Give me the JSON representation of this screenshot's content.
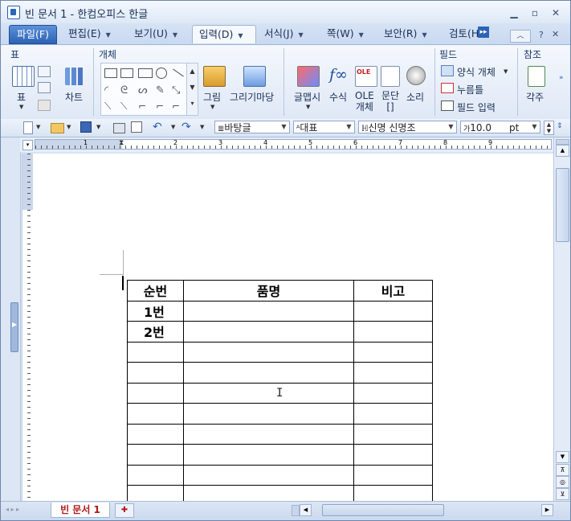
{
  "window": {
    "title": "빈 문서 1 - 한컴오피스 한글"
  },
  "menu_tabs": [
    {
      "label": "파일(F)"
    },
    {
      "label": "편집(E)"
    },
    {
      "label": "보기(U)"
    },
    {
      "label": "입력(D)"
    },
    {
      "label": "서식(J)"
    },
    {
      "label": "쪽(W)"
    },
    {
      "label": "보안(R)"
    },
    {
      "label": "검토(H"
    }
  ],
  "ribbon": {
    "group_table": "표",
    "group_object": "개체",
    "group_field": "필드",
    "group_ref": "참조",
    "btn_table": "표",
    "btn_chart": "차트",
    "btn_picture": "그림",
    "btn_gallery": "그리기마당",
    "btn_wordart": "글맵시",
    "btn_formula": "수식",
    "btn_ole_1": "OLE",
    "btn_ole_2": "개체",
    "btn_paragraph": "문단",
    "btn_paragraph_sub": "[]",
    "btn_sound": "소리",
    "btn_form_object": "양식 개체",
    "btn_click_here": "누름틀",
    "btn_field_input": "필드 입력",
    "btn_footnote": "각주",
    "ole_icon_text": "OLE"
  },
  "toolbar": {
    "style": "바탕글",
    "lang": "대표",
    "font": "신명 신명조",
    "size": "10.0",
    "unit": "pt"
  },
  "ruler_numbers": [
    "1",
    "2",
    "3",
    "4",
    "5",
    "6",
    "7",
    "8",
    "9"
  ],
  "table": {
    "headers": [
      "순번",
      "품명",
      "비고"
    ],
    "rows": [
      [
        "1번",
        "",
        ""
      ],
      [
        "2번",
        "",
        ""
      ],
      [
        "",
        "",
        ""
      ],
      [
        "",
        "",
        ""
      ],
      [
        "",
        "",
        ""
      ],
      [
        "",
        "",
        ""
      ],
      [
        "",
        "",
        ""
      ],
      [
        "",
        "",
        ""
      ],
      [
        "",
        "",
        ""
      ],
      [
        "",
        "",
        ""
      ]
    ]
  },
  "status": {
    "doc_tab": "빈 문서 1"
  }
}
